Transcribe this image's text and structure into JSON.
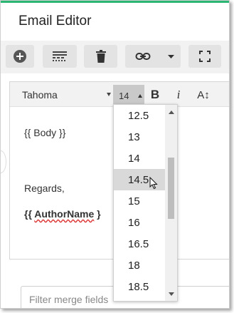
{
  "window": {
    "title": "Email Editor",
    "accent": "#2bb673"
  },
  "toolbar": {
    "buttons": [
      {
        "name": "add-button",
        "icon": "plus-circle-icon"
      },
      {
        "name": "formatting-button",
        "icon": "text-formatting-icon"
      },
      {
        "name": "delete-button",
        "icon": "trash-icon"
      },
      {
        "name": "insert-link-button",
        "icon": "link-icon"
      },
      {
        "name": "more-dropdown-button",
        "icon": "chevron-down-icon"
      },
      {
        "name": "fullscreen-button",
        "icon": "expand-icon"
      }
    ]
  },
  "editor": {
    "font": "Tahoma",
    "font_size": "14",
    "bold_label": "B",
    "italic_label": "i",
    "case_label": "A↕",
    "body_line": "{{ Body }}",
    "regards_line": "Regards,",
    "author_open": "{{ ",
    "author_name": "AuthorName",
    "author_close": " }"
  },
  "size_dropdown": {
    "options": [
      "12.5",
      "13",
      "14",
      "14.5",
      "15",
      "16",
      "16.5",
      "18",
      "18.5"
    ],
    "hover_index": 3
  },
  "filter": {
    "placeholder": "Filter merge fields"
  }
}
